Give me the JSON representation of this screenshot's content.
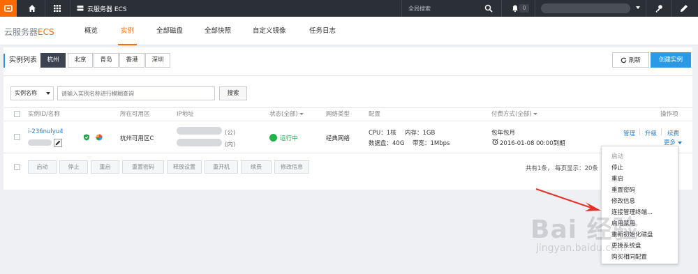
{
  "topbar": {
    "product": "云服务器 ECS",
    "search_placeholder": "全局搜索",
    "notification_count": "0"
  },
  "nav": {
    "brand_prefix": "云服务器",
    "brand_suffix": "ECS",
    "tabs": [
      "概览",
      "实例",
      "全部磁盘",
      "全部快照",
      "自定义镜像",
      "任务日志"
    ]
  },
  "panel": {
    "title": "实例列表",
    "regions": [
      "杭州",
      "北京",
      "青岛",
      "香港",
      "深圳"
    ],
    "refresh_label": "刷新",
    "create_label": "创建实例"
  },
  "filter": {
    "select_value": "实例名称",
    "input_placeholder": "请输入实例名称进行模糊查询",
    "search_label": "搜索"
  },
  "table": {
    "headers": {
      "id_name": "实例ID/名称",
      "zone": "所在可用区",
      "ip": "IP地址",
      "status": "状态(全部)",
      "network": "网络类型",
      "config": "配置",
      "billing": "付费方式(全部)",
      "actions": "操作项"
    },
    "row": {
      "instance_id": "i-236nulyu4",
      "zone": "杭州可用区C",
      "ip_public_suffix": "(公)",
      "ip_private_suffix": "(内)",
      "status": "运行中",
      "network": "经典网络",
      "cpu": "CPU：1核",
      "memory": "内存：1GB",
      "disk": "数据盘：40G",
      "bandwidth": "带宽：1Mbps",
      "billing_type": "包年包月",
      "expire": "2016-01-08 00:00到期",
      "action_manage": "管理",
      "action_upgrade": "升级",
      "action_renew": "续费",
      "action_more": "更多"
    }
  },
  "bulk_actions": [
    "启动",
    "停止",
    "重启",
    "重置密码",
    "释放设置",
    "重开机",
    "续费",
    "修改信息"
  ],
  "pager": {
    "text": "共有1条， 每页显示：20条"
  },
  "more_menu": {
    "items": [
      "启动",
      "停止",
      "重启",
      "重置密码",
      "修改信息",
      "连接管理终端...",
      "启用禁用",
      "重新初始化磁盘",
      "更换系统盘",
      "购买相同配置"
    ]
  },
  "watermark": {
    "big": "Bai 经验",
    "small": "jingyan.baidu.com"
  },
  "colors": {
    "accent": "#ff6a00",
    "primary": "#2a9ae6",
    "topbar": "#2b2f36",
    "status_running": "#22b14c"
  }
}
